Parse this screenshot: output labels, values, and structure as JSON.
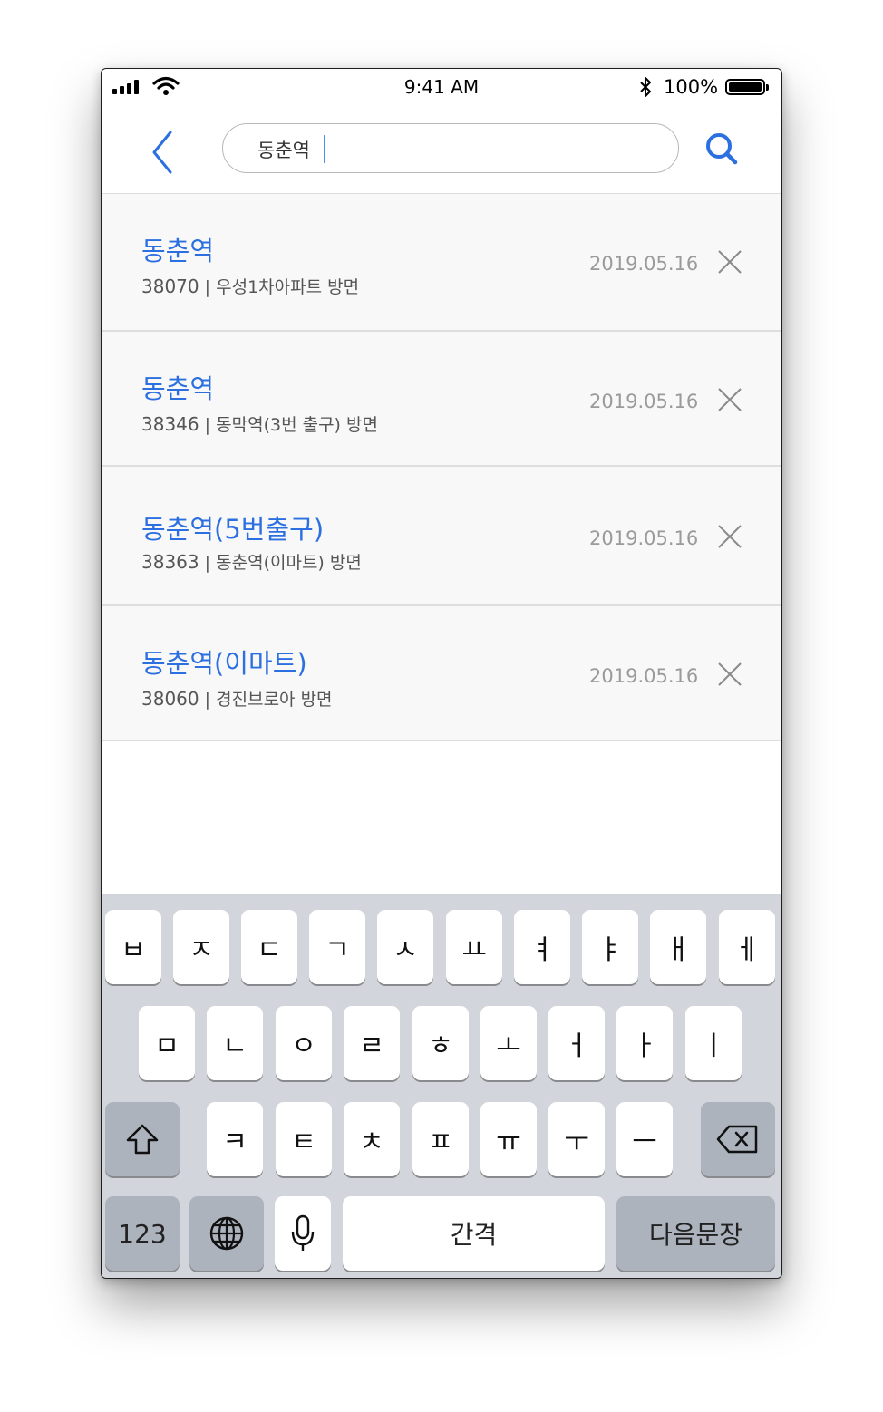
{
  "status_bar": {
    "time": "9:41 AM",
    "battery_percent": "100%",
    "battery_level": 1.0
  },
  "header": {
    "search_value": "동춘역",
    "back_icon": "chevron-left-icon",
    "search_icon": "search-icon"
  },
  "results": [
    {
      "title": "동춘역",
      "code": "38070",
      "separator": "|",
      "direction": "우성1차아파트 방면",
      "date": "2019.05.16"
    },
    {
      "title": "동춘역",
      "code": "38346",
      "separator": "|",
      "direction": "동막역(3번 출구) 방면",
      "date": "2019.05.16"
    },
    {
      "title": "동춘역(5번출구)",
      "code": "38363",
      "separator": "|",
      "direction": "동춘역(이마트) 방면",
      "date": "2019.05.16"
    },
    {
      "title": "동춘역(이마트)",
      "code": "38060",
      "separator": "|",
      "direction": "경진브로아 방면",
      "date": "2019.05.16"
    }
  ],
  "keyboard": {
    "row1": [
      "ㅂ",
      "ㅈ",
      "ㄷ",
      "ㄱ",
      "ㅅ",
      "ㅛ",
      "ㅕ",
      "ㅑ",
      "ㅐ",
      "ㅔ"
    ],
    "row2": [
      "ㅁ",
      "ㄴ",
      "ㅇ",
      "ㄹ",
      "ㅎ",
      "ㅗ",
      "ㅓ",
      "ㅏ",
      "ㅣ"
    ],
    "row3": [
      "ㅋ",
      "ㅌ",
      "ㅊ",
      "ㅍ",
      "ㅠ",
      "ㅜ",
      "ㅡ"
    ],
    "numbers_label": "123",
    "space_label": "간격",
    "return_label": "다음문장",
    "shift_icon": "shift-icon",
    "delete_icon": "delete-icon",
    "globe_icon": "globe-icon",
    "mic_icon": "microphone-icon"
  },
  "colors": {
    "accent": "#2c6fe0",
    "keyboard_bg": "#d2d5db",
    "list_bg": "#f8f8f8"
  }
}
